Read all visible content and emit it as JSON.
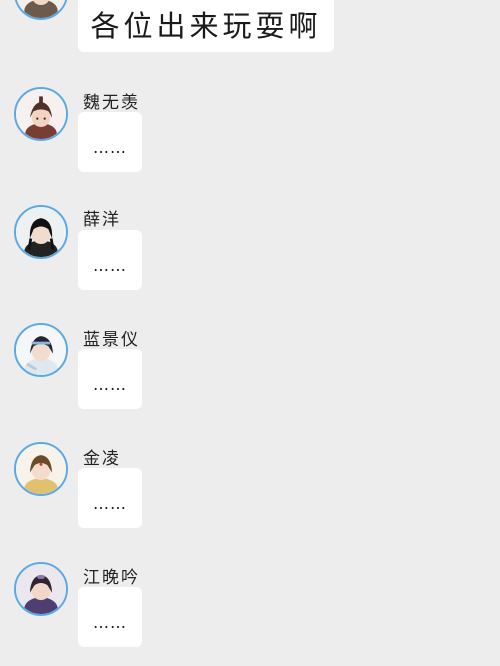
{
  "top_message": {
    "text": "各位出来玩耍啊"
  },
  "messages": [
    {
      "name": "魏无羡",
      "text": "……",
      "avatar_icon": "wei-wuxian-avatar-icon"
    },
    {
      "name": "薛洋",
      "text": "……",
      "avatar_icon": "xue-yang-avatar-icon"
    },
    {
      "name": "蓝景仪",
      "text": "……",
      "avatar_icon": "lan-jingyi-avatar-icon"
    },
    {
      "name": "金凌",
      "text": "……",
      "avatar_icon": "jin-ling-avatar-icon"
    },
    {
      "name": "江晚吟",
      "text": "……",
      "avatar_icon": "jiang-wanyin-avatar-icon"
    }
  ],
  "colors": {
    "background": "#ededed",
    "bubble": "#ffffff",
    "avatar_ring": "#5aa9e6"
  }
}
